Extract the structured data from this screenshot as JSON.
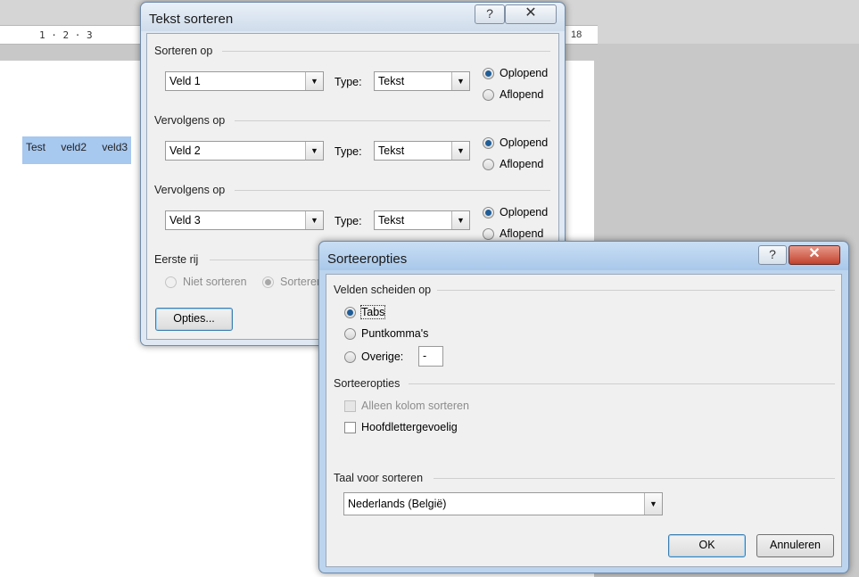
{
  "document": {
    "ruler_left": "1 · 2 · 3",
    "ruler_right": "18",
    "selected_text": "Test veld2 veld3"
  },
  "sort_dialog": {
    "title": "Tekst sorteren",
    "help_icon": "?",
    "close_icon": "✕",
    "groups": [
      {
        "heading": "Sorteren op",
        "field": "Veld 1",
        "type_label": "Type:",
        "type_value": "Tekst",
        "ascending": "Oplopend",
        "descending": "Aflopend",
        "selected": "ascending"
      },
      {
        "heading": "Vervolgens op",
        "field": "Veld 2",
        "type_label": "Type:",
        "type_value": "Tekst",
        "ascending": "Oplopend",
        "descending": "Aflopend",
        "selected": "ascending"
      },
      {
        "heading": "Vervolgens op",
        "field": "Veld 3",
        "type_label": "Type:",
        "type_value": "Tekst",
        "ascending": "Oplopend",
        "descending": "Aflopend",
        "selected": "ascending"
      }
    ],
    "first_row": {
      "heading": "Eerste rij",
      "option_no_sort": "Niet sorteren",
      "option_sort": "Sorteren"
    },
    "options_button": "Opties..."
  },
  "options_dialog": {
    "title": "Sorteeropties",
    "help_icon": "?",
    "close_icon": "✕",
    "separator_section": "Velden scheiden op",
    "separator_tabs": "Tabs",
    "separator_semicolons": "Puntkomma's",
    "separator_other": "Overige:",
    "separator_other_value": "-",
    "separator_selected": "Tabs",
    "sort_options_section": "Sorteeropties",
    "only_column": "Alleen kolom sorteren",
    "case_sensitive": "Hoofdlettergevoelig",
    "language_section": "Taal voor sorteren",
    "language_value": "Nederlands (België)",
    "ok_button": "OK",
    "cancel_button": "Annuleren"
  }
}
